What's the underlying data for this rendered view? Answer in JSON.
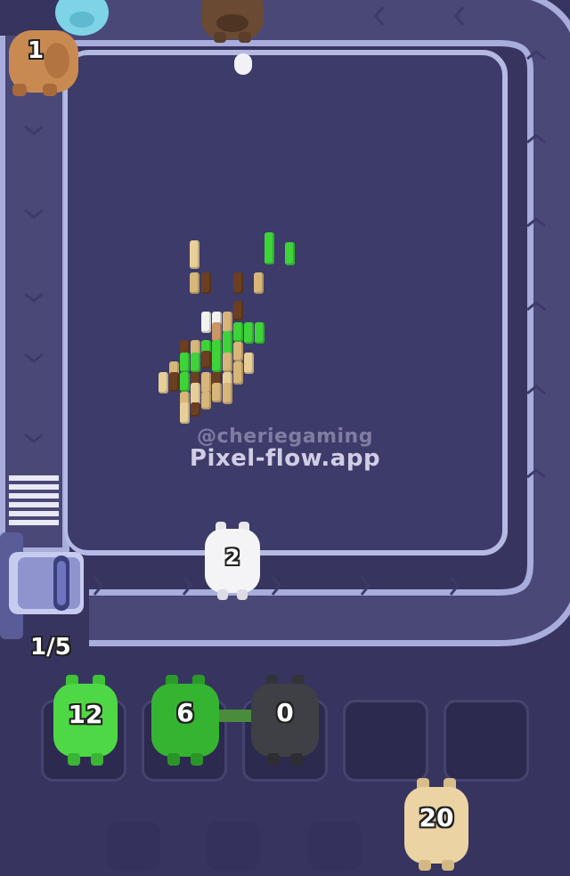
{
  "watermark": {
    "handle": "@cheriegaming",
    "site": "Pixel-flow.app"
  },
  "queue_counter": "1/5",
  "conveyor_pigs": [
    {
      "color": "#f4f4f4",
      "count": "2"
    }
  ],
  "top_pigs": [
    {
      "color": "#c98a52",
      "count": "1"
    },
    {
      "color": "#7ed4e6",
      "count": ""
    },
    {
      "color": "#6a4a32",
      "count": ""
    }
  ],
  "slot_pigs": [
    {
      "color": "#4fd845",
      "count": "12"
    },
    {
      "color": "#35b431",
      "count": "6"
    },
    {
      "color": "#3f3f46",
      "count": "0"
    }
  ],
  "waiting_pig": {
    "color": "#ecd3a4",
    "count": "20"
  },
  "colors": {
    "background": "#37355f",
    "board": "#3d3b6a",
    "track": "#4a4877",
    "track_rail": "#a9addc"
  }
}
